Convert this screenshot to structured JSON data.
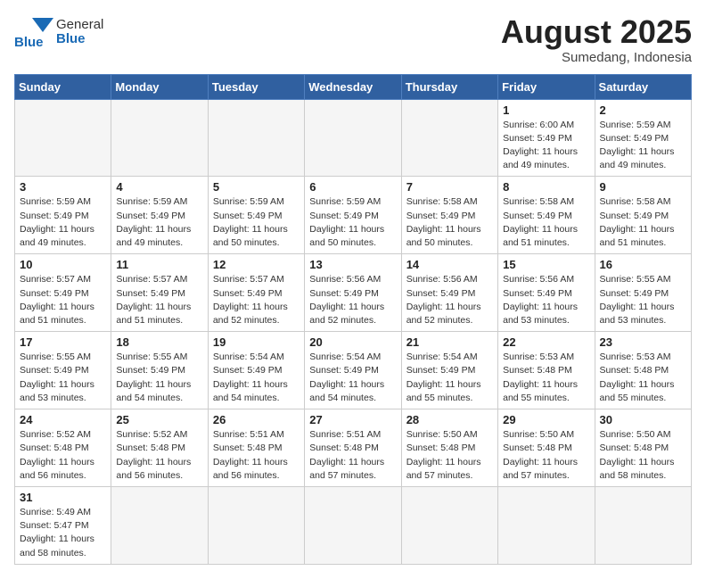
{
  "header": {
    "logo_text_normal": "General",
    "logo_text_bold": "Blue",
    "month_title": "August 2025",
    "location": "Sumedang, Indonesia"
  },
  "weekdays": [
    "Sunday",
    "Monday",
    "Tuesday",
    "Wednesday",
    "Thursday",
    "Friday",
    "Saturday"
  ],
  "weeks": [
    [
      {
        "day": "",
        "info": ""
      },
      {
        "day": "",
        "info": ""
      },
      {
        "day": "",
        "info": ""
      },
      {
        "day": "",
        "info": ""
      },
      {
        "day": "",
        "info": ""
      },
      {
        "day": "1",
        "info": "Sunrise: 6:00 AM\nSunset: 5:49 PM\nDaylight: 11 hours and 49 minutes."
      },
      {
        "day": "2",
        "info": "Sunrise: 5:59 AM\nSunset: 5:49 PM\nDaylight: 11 hours and 49 minutes."
      }
    ],
    [
      {
        "day": "3",
        "info": "Sunrise: 5:59 AM\nSunset: 5:49 PM\nDaylight: 11 hours and 49 minutes."
      },
      {
        "day": "4",
        "info": "Sunrise: 5:59 AM\nSunset: 5:49 PM\nDaylight: 11 hours and 49 minutes."
      },
      {
        "day": "5",
        "info": "Sunrise: 5:59 AM\nSunset: 5:49 PM\nDaylight: 11 hours and 50 minutes."
      },
      {
        "day": "6",
        "info": "Sunrise: 5:59 AM\nSunset: 5:49 PM\nDaylight: 11 hours and 50 minutes."
      },
      {
        "day": "7",
        "info": "Sunrise: 5:58 AM\nSunset: 5:49 PM\nDaylight: 11 hours and 50 minutes."
      },
      {
        "day": "8",
        "info": "Sunrise: 5:58 AM\nSunset: 5:49 PM\nDaylight: 11 hours and 51 minutes."
      },
      {
        "day": "9",
        "info": "Sunrise: 5:58 AM\nSunset: 5:49 PM\nDaylight: 11 hours and 51 minutes."
      }
    ],
    [
      {
        "day": "10",
        "info": "Sunrise: 5:57 AM\nSunset: 5:49 PM\nDaylight: 11 hours and 51 minutes."
      },
      {
        "day": "11",
        "info": "Sunrise: 5:57 AM\nSunset: 5:49 PM\nDaylight: 11 hours and 51 minutes."
      },
      {
        "day": "12",
        "info": "Sunrise: 5:57 AM\nSunset: 5:49 PM\nDaylight: 11 hours and 52 minutes."
      },
      {
        "day": "13",
        "info": "Sunrise: 5:56 AM\nSunset: 5:49 PM\nDaylight: 11 hours and 52 minutes."
      },
      {
        "day": "14",
        "info": "Sunrise: 5:56 AM\nSunset: 5:49 PM\nDaylight: 11 hours and 52 minutes."
      },
      {
        "day": "15",
        "info": "Sunrise: 5:56 AM\nSunset: 5:49 PM\nDaylight: 11 hours and 53 minutes."
      },
      {
        "day": "16",
        "info": "Sunrise: 5:55 AM\nSunset: 5:49 PM\nDaylight: 11 hours and 53 minutes."
      }
    ],
    [
      {
        "day": "17",
        "info": "Sunrise: 5:55 AM\nSunset: 5:49 PM\nDaylight: 11 hours and 53 minutes."
      },
      {
        "day": "18",
        "info": "Sunrise: 5:55 AM\nSunset: 5:49 PM\nDaylight: 11 hours and 54 minutes."
      },
      {
        "day": "19",
        "info": "Sunrise: 5:54 AM\nSunset: 5:49 PM\nDaylight: 11 hours and 54 minutes."
      },
      {
        "day": "20",
        "info": "Sunrise: 5:54 AM\nSunset: 5:49 PM\nDaylight: 11 hours and 54 minutes."
      },
      {
        "day": "21",
        "info": "Sunrise: 5:54 AM\nSunset: 5:49 PM\nDaylight: 11 hours and 55 minutes."
      },
      {
        "day": "22",
        "info": "Sunrise: 5:53 AM\nSunset: 5:48 PM\nDaylight: 11 hours and 55 minutes."
      },
      {
        "day": "23",
        "info": "Sunrise: 5:53 AM\nSunset: 5:48 PM\nDaylight: 11 hours and 55 minutes."
      }
    ],
    [
      {
        "day": "24",
        "info": "Sunrise: 5:52 AM\nSunset: 5:48 PM\nDaylight: 11 hours and 56 minutes."
      },
      {
        "day": "25",
        "info": "Sunrise: 5:52 AM\nSunset: 5:48 PM\nDaylight: 11 hours and 56 minutes."
      },
      {
        "day": "26",
        "info": "Sunrise: 5:51 AM\nSunset: 5:48 PM\nDaylight: 11 hours and 56 minutes."
      },
      {
        "day": "27",
        "info": "Sunrise: 5:51 AM\nSunset: 5:48 PM\nDaylight: 11 hours and 57 minutes."
      },
      {
        "day": "28",
        "info": "Sunrise: 5:50 AM\nSunset: 5:48 PM\nDaylight: 11 hours and 57 minutes."
      },
      {
        "day": "29",
        "info": "Sunrise: 5:50 AM\nSunset: 5:48 PM\nDaylight: 11 hours and 57 minutes."
      },
      {
        "day": "30",
        "info": "Sunrise: 5:50 AM\nSunset: 5:48 PM\nDaylight: 11 hours and 58 minutes."
      }
    ],
    [
      {
        "day": "31",
        "info": "Sunrise: 5:49 AM\nSunset: 5:47 PM\nDaylight: 11 hours and 58 minutes."
      },
      {
        "day": "",
        "info": ""
      },
      {
        "day": "",
        "info": ""
      },
      {
        "day": "",
        "info": ""
      },
      {
        "day": "",
        "info": ""
      },
      {
        "day": "",
        "info": ""
      },
      {
        "day": "",
        "info": ""
      }
    ]
  ]
}
